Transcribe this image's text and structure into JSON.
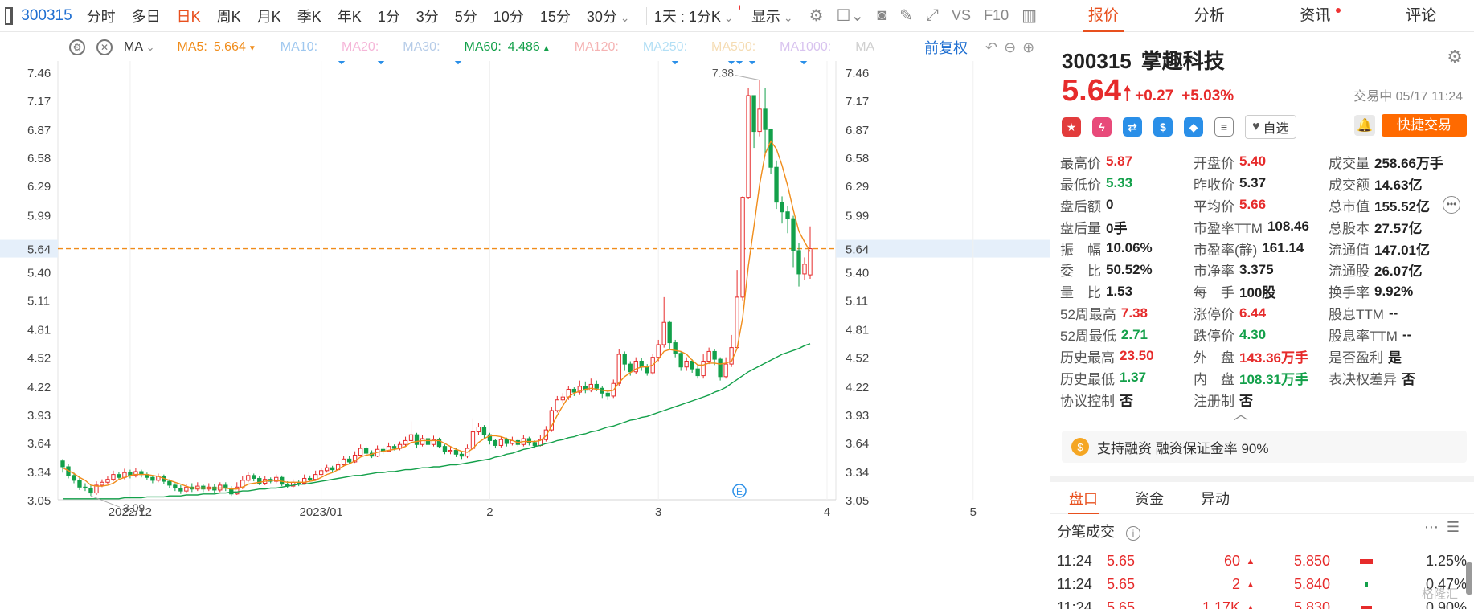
{
  "toolbar": {
    "code": "300315",
    "periods": [
      "分时",
      "多日",
      "日K",
      "周K",
      "月K",
      "季K",
      "年K",
      "1分",
      "3分",
      "5分",
      "10分",
      "15分",
      "30分"
    ],
    "active_period": "日K",
    "range_label": "1天 : 1分K",
    "display_label": "显示",
    "vs_label": "VS",
    "f10_label": "F10"
  },
  "ma": {
    "label": "MA",
    "items": [
      {
        "label": "MA5:",
        "value": "5.664",
        "color": "#f08c1a",
        "mark": "▼"
      },
      {
        "label": "MA10:",
        "value": "",
        "color": "#9ec7ef",
        "mark": ""
      },
      {
        "label": "MA20:",
        "value": "",
        "color": "#f5b6d8",
        "mark": ""
      },
      {
        "label": "MA30:",
        "value": "",
        "color": "#b6cce8",
        "mark": ""
      },
      {
        "label": "MA60:",
        "value": "4.486",
        "color": "#13a04a",
        "mark": "▲"
      },
      {
        "label": "MA120:",
        "value": "",
        "color": "#f5b3b3",
        "mark": ""
      },
      {
        "label": "MA250:",
        "value": "",
        "color": "#b3dff5",
        "mark": ""
      },
      {
        "label": "MA500:",
        "value": "",
        "color": "#f5dcb3",
        "mark": ""
      },
      {
        "label": "MA1000:",
        "value": "",
        "color": "#d8c3ef",
        "mark": ""
      },
      {
        "label": "MA",
        "value": "",
        "color": "#cfcfcf",
        "mark": ""
      }
    ],
    "restore_label": "前复权"
  },
  "chart_data": {
    "type": "candlestick",
    "y_ticks": [
      "7.46",
      "7.17",
      "6.87",
      "6.58",
      "6.29",
      "5.99",
      "5.64",
      "5.40",
      "5.11",
      "4.81",
      "4.52",
      "4.22",
      "3.93",
      "3.64",
      "3.34",
      "3.05"
    ],
    "y_range": [
      3.05,
      7.46
    ],
    "x_labels": [
      "2022/12",
      "2023/01",
      "2",
      "3",
      "4",
      "5"
    ],
    "current_price_label": "5.64",
    "high_annotation": "7.38",
    "low_annotation": "3.09",
    "ma_colors": {
      "ma5": "#f08c1a",
      "ma60": "#13a04a"
    },
    "candle_colors": {
      "up": "#e62b2b",
      "down": "#13a04a"
    },
    "event_marker": "E",
    "candles": [
      [
        3.45,
        3.39,
        3.47,
        3.33
      ],
      [
        3.39,
        3.3,
        3.42,
        3.27
      ],
      [
        3.3,
        3.25,
        3.33,
        3.22
      ],
      [
        3.25,
        3.18,
        3.28,
        3.15
      ],
      [
        3.18,
        3.17,
        3.22,
        3.14
      ],
      [
        3.17,
        3.12,
        3.2,
        3.09
      ],
      [
        3.12,
        3.2,
        3.24,
        3.1
      ],
      [
        3.2,
        3.23,
        3.26,
        3.18
      ],
      [
        3.23,
        3.26,
        3.29,
        3.21
      ],
      [
        3.26,
        3.31,
        3.35,
        3.24
      ],
      [
        3.31,
        3.28,
        3.34,
        3.25
      ],
      [
        3.28,
        3.33,
        3.37,
        3.26
      ],
      [
        3.33,
        3.3,
        3.36,
        3.27
      ],
      [
        3.3,
        3.34,
        3.38,
        3.28
      ],
      [
        3.34,
        3.31,
        3.36,
        3.28
      ],
      [
        3.31,
        3.28,
        3.33,
        3.25
      ],
      [
        3.28,
        3.25,
        3.3,
        3.22
      ],
      [
        3.25,
        3.29,
        3.32,
        3.23
      ],
      [
        3.29,
        3.24,
        3.31,
        3.21
      ],
      [
        3.24,
        3.2,
        3.26,
        3.17
      ],
      [
        3.2,
        3.17,
        3.22,
        3.14
      ],
      [
        3.17,
        3.14,
        3.2,
        3.11
      ],
      [
        3.14,
        3.18,
        3.21,
        3.12
      ],
      [
        3.18,
        3.16,
        3.22,
        3.13
      ],
      [
        3.16,
        3.19,
        3.23,
        3.14
      ],
      [
        3.19,
        3.16,
        3.21,
        3.13
      ],
      [
        3.16,
        3.18,
        3.22,
        3.14
      ],
      [
        3.18,
        3.15,
        3.21,
        3.12
      ],
      [
        3.15,
        3.2,
        3.23,
        3.13
      ],
      [
        3.2,
        3.17,
        3.23,
        3.14
      ],
      [
        3.17,
        3.11,
        3.19,
        3.09
      ],
      [
        3.11,
        3.18,
        3.23,
        3.1
      ],
      [
        3.18,
        3.25,
        3.29,
        3.16
      ],
      [
        3.25,
        3.3,
        3.34,
        3.23
      ],
      [
        3.3,
        3.27,
        3.32,
        3.24
      ],
      [
        3.27,
        3.22,
        3.29,
        3.2
      ],
      [
        3.22,
        3.26,
        3.29,
        3.2
      ],
      [
        3.26,
        3.24,
        3.28,
        3.22
      ],
      [
        3.24,
        3.28,
        3.31,
        3.22
      ],
      [
        3.28,
        3.21,
        3.3,
        3.19
      ],
      [
        3.21,
        3.19,
        3.24,
        3.17
      ],
      [
        3.19,
        3.23,
        3.26,
        3.17
      ],
      [
        3.23,
        3.22,
        3.25,
        3.19
      ],
      [
        3.22,
        3.27,
        3.31,
        3.21
      ],
      [
        3.27,
        3.26,
        3.3,
        3.24
      ],
      [
        3.26,
        3.31,
        3.35,
        3.25
      ],
      [
        3.31,
        3.35,
        3.38,
        3.3
      ],
      [
        3.35,
        3.38,
        3.41,
        3.33
      ],
      [
        3.38,
        3.36,
        3.4,
        3.34
      ],
      [
        3.36,
        3.41,
        3.45,
        3.35
      ],
      [
        3.41,
        3.47,
        3.5,
        3.39
      ],
      [
        3.47,
        3.44,
        3.5,
        3.42
      ],
      [
        3.44,
        3.51,
        3.55,
        3.43
      ],
      [
        3.51,
        3.58,
        3.62,
        3.5
      ],
      [
        3.58,
        3.53,
        3.6,
        3.5
      ],
      [
        3.53,
        3.5,
        3.56,
        3.48
      ],
      [
        3.5,
        3.57,
        3.61,
        3.49
      ],
      [
        3.57,
        3.55,
        3.6,
        3.52
      ],
      [
        3.55,
        3.6,
        3.64,
        3.54
      ],
      [
        3.6,
        3.58,
        3.62,
        3.56
      ],
      [
        3.58,
        3.62,
        3.65,
        3.56
      ],
      [
        3.62,
        3.66,
        3.7,
        3.6
      ],
      [
        3.66,
        3.72,
        3.86,
        3.64
      ],
      [
        3.72,
        3.62,
        3.74,
        3.58
      ],
      [
        3.62,
        3.68,
        3.72,
        3.6
      ],
      [
        3.68,
        3.62,
        3.7,
        3.6
      ],
      [
        3.62,
        3.67,
        3.71,
        3.6
      ],
      [
        3.67,
        3.6,
        3.69,
        3.58
      ],
      [
        3.6,
        3.55,
        3.62,
        3.52
      ],
      [
        3.55,
        3.56,
        3.6,
        3.52
      ],
      [
        3.56,
        3.52,
        3.58,
        3.49
      ],
      [
        3.52,
        3.5,
        3.55,
        3.47
      ],
      [
        3.5,
        3.58,
        3.62,
        3.48
      ],
      [
        3.58,
        3.75,
        3.89,
        3.56
      ],
      [
        3.75,
        3.8,
        3.84,
        3.72
      ],
      [
        3.8,
        3.72,
        3.82,
        3.68
      ],
      [
        3.72,
        3.66,
        3.74,
        3.62
      ],
      [
        3.66,
        3.61,
        3.68,
        3.58
      ],
      [
        3.61,
        3.67,
        3.7,
        3.59
      ],
      [
        3.67,
        3.63,
        3.69,
        3.6
      ],
      [
        3.63,
        3.66,
        3.7,
        3.61
      ],
      [
        3.66,
        3.62,
        3.68,
        3.6
      ],
      [
        3.62,
        3.68,
        3.72,
        3.6
      ],
      [
        3.68,
        3.64,
        3.7,
        3.61
      ],
      [
        3.64,
        3.61,
        3.66,
        3.58
      ],
      [
        3.61,
        3.67,
        3.72,
        3.6
      ],
      [
        3.67,
        3.77,
        3.81,
        3.65
      ],
      [
        3.77,
        3.97,
        4.01,
        3.75
      ],
      [
        3.97,
        4.08,
        4.12,
        3.95
      ],
      [
        4.08,
        4.11,
        4.15,
        4.05
      ],
      [
        4.11,
        4.19,
        4.22,
        4.08
      ],
      [
        4.19,
        4.16,
        4.21,
        4.12
      ],
      [
        4.16,
        4.22,
        4.28,
        4.13
      ],
      [
        4.22,
        4.18,
        4.27,
        4.15
      ],
      [
        4.18,
        4.24,
        4.3,
        4.16
      ],
      [
        4.24,
        4.2,
        4.28,
        4.17
      ],
      [
        4.2,
        4.15,
        4.22,
        4.1
      ],
      [
        4.15,
        4.12,
        4.18,
        4.08
      ],
      [
        4.12,
        4.25,
        4.29,
        4.1
      ],
      [
        4.25,
        4.55,
        4.6,
        4.22
      ],
      [
        4.55,
        4.45,
        4.58,
        4.38
      ],
      [
        4.45,
        4.37,
        4.48,
        4.33
      ],
      [
        4.37,
        4.48,
        4.52,
        4.35
      ],
      [
        4.48,
        4.42,
        4.51,
        4.38
      ],
      [
        4.42,
        4.36,
        4.45,
        4.33
      ],
      [
        4.36,
        4.52,
        4.55,
        4.34
      ],
      [
        4.52,
        4.65,
        4.7,
        4.48
      ],
      [
        4.65,
        4.88,
        5.14,
        4.62
      ],
      [
        4.88,
        4.67,
        4.9,
        4.6
      ],
      [
        4.67,
        4.56,
        4.7,
        4.52
      ],
      [
        4.56,
        4.42,
        4.58,
        4.38
      ],
      [
        4.42,
        4.48,
        4.52,
        4.38
      ],
      [
        4.48,
        4.4,
        4.5,
        4.36
      ],
      [
        4.4,
        4.33,
        4.45,
        4.3
      ],
      [
        4.33,
        4.48,
        4.55,
        4.3
      ],
      [
        4.48,
        4.58,
        4.62,
        4.45
      ],
      [
        4.58,
        4.5,
        4.6,
        4.44
      ],
      [
        4.5,
        4.32,
        4.52,
        4.28
      ],
      [
        4.32,
        4.45,
        4.52,
        4.3
      ],
      [
        4.45,
        4.62,
        4.75,
        4.42
      ],
      [
        4.62,
        5.14,
        5.42,
        4.6
      ],
      [
        5.14,
        6.17,
        6.18,
        5.1
      ],
      [
        6.17,
        7.22,
        7.3,
        6.15
      ],
      [
        7.22,
        6.85,
        7.1,
        6.68
      ],
      [
        6.85,
        7.08,
        7.38,
        6.8
      ],
      [
        7.08,
        6.87,
        7.3,
        6.6
      ],
      [
        6.87,
        6.48,
        6.88,
        6.41
      ],
      [
        6.48,
        6.12,
        6.55,
        6.05
      ],
      [
        6.12,
        6.02,
        6.18,
        5.9
      ],
      [
        6.02,
        5.95,
        6.08,
        5.8
      ],
      [
        5.95,
        5.62,
        5.98,
        5.45
      ],
      [
        5.62,
        5.38,
        5.7,
        5.25
      ],
      [
        5.38,
        5.48,
        5.55,
        5.32
      ],
      [
        5.37,
        5.64,
        5.87,
        5.33
      ]
    ],
    "ma5": [
      3.38,
      3.35,
      3.32,
      3.28,
      3.25,
      3.2,
      3.19,
      3.19,
      3.2,
      3.22,
      3.26,
      3.28,
      3.3,
      3.31,
      3.31,
      3.31,
      3.3,
      3.29,
      3.27,
      3.25,
      3.23,
      3.21,
      3.19,
      3.17,
      3.17,
      3.17,
      3.17,
      3.17,
      3.17,
      3.17,
      3.16,
      3.16,
      3.18,
      3.21,
      3.22,
      3.23,
      3.24,
      3.25,
      3.25,
      3.24,
      3.23,
      3.23,
      3.23,
      3.23,
      3.24,
      3.25,
      3.28,
      3.31,
      3.33,
      3.36,
      3.4,
      3.42,
      3.45,
      3.49,
      3.51,
      3.52,
      3.54,
      3.55,
      3.56,
      3.57,
      3.58,
      3.6,
      3.64,
      3.65,
      3.66,
      3.66,
      3.66,
      3.66,
      3.63,
      3.6,
      3.57,
      3.55,
      3.54,
      3.58,
      3.64,
      3.68,
      3.71,
      3.71,
      3.7,
      3.68,
      3.66,
      3.64,
      3.65,
      3.65,
      3.65,
      3.66,
      3.71,
      3.81,
      3.92,
      4.02,
      4.11,
      4.15,
      4.17,
      4.19,
      4.2,
      4.19,
      4.18,
      4.17,
      4.18,
      4.26,
      4.32,
      4.36,
      4.4,
      4.42,
      4.42,
      4.44,
      4.5,
      4.58,
      4.6,
      4.59,
      4.58,
      4.55,
      4.49,
      4.44,
      4.44,
      4.46,
      4.46,
      4.45,
      4.46,
      4.48,
      4.61,
      4.93,
      5.46,
      5.87,
      6.3,
      6.62,
      6.75,
      6.67,
      6.5,
      6.29,
      6.04,
      5.82,
      5.71,
      5.61
    ],
    "ma60": [
      3.06,
      3.06,
      3.06,
      3.06,
      3.06,
      3.06,
      3.06,
      3.06,
      3.06,
      3.06,
      3.06,
      3.07,
      3.07,
      3.07,
      3.07,
      3.08,
      3.08,
      3.08,
      3.08,
      3.09,
      3.09,
      3.09,
      3.1,
      3.1,
      3.1,
      3.11,
      3.11,
      3.11,
      3.12,
      3.12,
      3.13,
      3.13,
      3.14,
      3.14,
      3.15,
      3.16,
      3.16,
      3.17,
      3.17,
      3.18,
      3.19,
      3.2,
      3.21,
      3.21,
      3.22,
      3.23,
      3.24,
      3.25,
      3.26,
      3.27,
      3.28,
      3.29,
      3.3,
      3.3,
      3.31,
      3.32,
      3.33,
      3.33,
      3.34,
      3.34,
      3.35,
      3.36,
      3.36,
      3.37,
      3.38,
      3.38,
      3.39,
      3.39,
      3.4,
      3.41,
      3.41,
      3.42,
      3.43,
      3.44,
      3.45,
      3.46,
      3.47,
      3.49,
      3.5,
      3.52,
      3.53,
      3.55,
      3.57,
      3.58,
      3.6,
      3.61,
      3.63,
      3.64,
      3.66,
      3.67,
      3.69,
      3.7,
      3.72,
      3.73,
      3.75,
      3.76,
      3.78,
      3.8,
      3.81,
      3.83,
      3.85,
      3.87,
      3.88,
      3.9,
      3.91,
      3.93,
      3.95,
      3.97,
      3.99,
      4.01,
      4.03,
      4.05,
      4.07,
      4.09,
      4.11,
      4.13,
      4.16,
      4.18,
      4.21,
      4.25,
      4.29,
      4.33,
      4.37,
      4.4,
      4.43,
      4.46,
      4.49,
      4.52,
      4.55,
      4.57,
      4.59,
      4.61,
      4.64,
      4.66
    ]
  },
  "stock": {
    "code": "300315",
    "name": "掌趣科技",
    "price": "5.64",
    "change": "+0.27",
    "change_pct": "+5.03%",
    "status_time": "交易中 05/17 11:24",
    "watch_label": "自选",
    "quick_trade_label": "快捷交易"
  },
  "quote_tabs": [
    "报价",
    "分析",
    "资讯",
    "评论"
  ],
  "quote_col1": [
    {
      "label": "最高价",
      "value": "5.87",
      "tone": "up"
    },
    {
      "label": "最低价",
      "value": "5.33",
      "tone": "dn"
    },
    {
      "label": "盘后额",
      "value": "0",
      "tone": ""
    },
    {
      "label": "盘后量",
      "value": "0手",
      "tone": ""
    },
    {
      "label": "振　幅",
      "value": "10.06%",
      "tone": ""
    },
    {
      "label": "委　比",
      "value": "50.52%",
      "tone": ""
    },
    {
      "label": "量　比",
      "value": "1.53",
      "tone": ""
    },
    {
      "label": "52周最高",
      "value": "7.38",
      "tone": "up"
    },
    {
      "label": "52周最低",
      "value": "2.71",
      "tone": "dn"
    },
    {
      "label": "历史最高",
      "value": "23.50",
      "tone": "up"
    },
    {
      "label": "历史最低",
      "value": "1.37",
      "tone": "dn"
    },
    {
      "label": "协议控制",
      "value": "否",
      "tone": ""
    }
  ],
  "quote_col2": [
    {
      "label": "开盘价",
      "value": "5.40",
      "tone": "up"
    },
    {
      "label": "昨收价",
      "value": "5.37",
      "tone": ""
    },
    {
      "label": "平均价",
      "value": "5.66",
      "tone": "up"
    },
    {
      "label": "市盈率TTM",
      "value": "108.46",
      "tone": ""
    },
    {
      "label": "市盈率(静)",
      "value": "161.14",
      "tone": ""
    },
    {
      "label": "市净率",
      "value": "3.375",
      "tone": ""
    },
    {
      "label": "每　手",
      "value": "100股",
      "tone": ""
    },
    {
      "label": "涨停价",
      "value": "6.44",
      "tone": "up"
    },
    {
      "label": "跌停价",
      "value": "4.30",
      "tone": "dn"
    },
    {
      "label": "外　盘",
      "value": "143.36万手",
      "tone": "up"
    },
    {
      "label": "内　盘",
      "value": "108.31万手",
      "tone": "dn"
    },
    {
      "label": "注册制",
      "value": "否",
      "tone": ""
    }
  ],
  "quote_col3": [
    {
      "label": "成交量",
      "value": "258.66万手",
      "tone": ""
    },
    {
      "label": "成交额",
      "value": "14.63亿",
      "tone": ""
    },
    {
      "label": "总市值",
      "value": "155.52亿",
      "tone": ""
    },
    {
      "label": "总股本",
      "value": "27.57亿",
      "tone": ""
    },
    {
      "label": "流通值",
      "value": "147.01亿",
      "tone": ""
    },
    {
      "label": "流通股",
      "value": "26.07亿",
      "tone": ""
    },
    {
      "label": "换手率",
      "value": "9.92%",
      "tone": ""
    },
    {
      "label": "股息TTM",
      "value": "--",
      "tone": ""
    },
    {
      "label": "股息率TTM",
      "value": "--",
      "tone": ""
    },
    {
      "label": "是否盈利",
      "value": "是",
      "tone": ""
    },
    {
      "label": "表决权差异",
      "value": "否",
      "tone": ""
    }
  ],
  "margin_text": "支持融资 融资保证金率 90%",
  "sub_tabs": [
    "盘口",
    "资金",
    "异动"
  ],
  "ticks_title": "分笔成交",
  "ticks": [
    {
      "time": "11:24",
      "price": "5.65",
      "vol": "60",
      "dir": "▲",
      "amount": "5.850",
      "bar_color": "#e62b2b",
      "bar_fill": 0.6,
      "pct": "1.25%"
    },
    {
      "time": "11:24",
      "price": "5.65",
      "vol": "2",
      "dir": "▲",
      "amount": "5.840",
      "bar_color": "#13a04a",
      "bar_fill": 0.15,
      "pct": "0.47%"
    },
    {
      "time": "11:24",
      "price": "5.65",
      "vol": "1.17K",
      "dir": "▲",
      "amount": "5.830",
      "bar_color": "#e62b2b",
      "bar_fill": 0.5,
      "pct": "0.90%"
    }
  ],
  "watermark": "格隆汇"
}
